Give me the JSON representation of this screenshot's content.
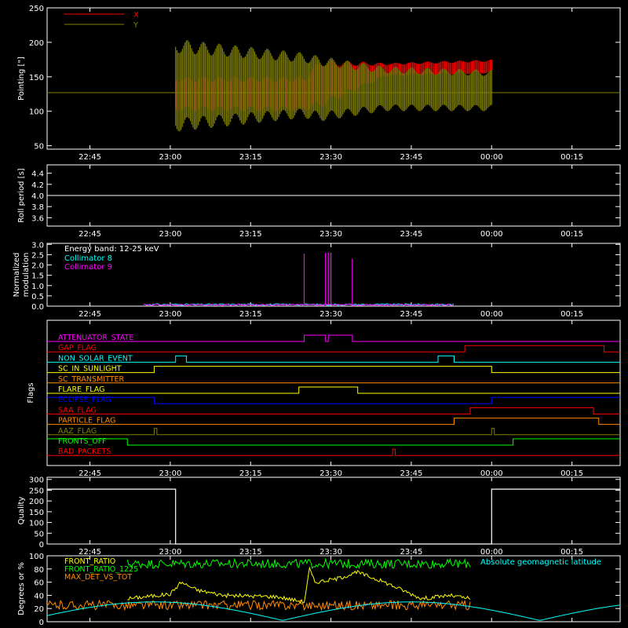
{
  "colors": {
    "background": "#000000",
    "axes": "#ffffff",
    "x": "#ff0000",
    "y": "#808000",
    "collimator8": "#00ffff",
    "collimator9": "#ff00ff",
    "front_ratio": "#ffff00",
    "front_ratio_1225": "#00ff00",
    "max_det": "#ff8c00",
    "geomag": "#00ffff"
  },
  "time_ticks": [
    "22:45",
    "23:00",
    "23:15",
    "23:30",
    "23:45",
    "00:00",
    "00:15"
  ],
  "chart_data": [
    {
      "id": "pointing",
      "type": "area",
      "ylabel": "Pointing [\"]",
      "ylim": [
        45,
        250
      ],
      "yticks": [
        "50",
        "100",
        "150",
        "200",
        "250"
      ],
      "x_range": [
        "22:37",
        "00:24"
      ],
      "legend": {
        "position": "top-left"
      },
      "reference_line": 127,
      "series": [
        {
          "name": "X",
          "color": "#ff0000",
          "x": [
            "23:01",
            "23:25",
            "23:28",
            "23:40",
            "00:00"
          ],
          "low": [
            100,
            100,
            105,
            150,
            155
          ],
          "high": [
            150,
            150,
            175,
            170,
            175
          ]
        },
        {
          "name": "Y",
          "color": "#808000",
          "x": [
            "23:01",
            "23:25",
            "23:28",
            "23:40",
            "00:00"
          ],
          "low": [
            70,
            90,
            85,
            100,
            100
          ],
          "high": [
            205,
            185,
            180,
            165,
            160
          ]
        }
      ]
    },
    {
      "id": "roll",
      "type": "line",
      "ylabel": "Roll period [s]",
      "ylim": [
        3.45,
        4.55
      ],
      "yticks": [
        "3.6",
        "3.8",
        "4.0",
        "4.2",
        "4.4"
      ],
      "x_range": [
        "22:37",
        "00:24"
      ],
      "series": [
        {
          "name": "",
          "x": [
            "22:37",
            "00:24"
          ],
          "values": [
            4.0,
            4.0
          ]
        }
      ]
    },
    {
      "id": "modulation",
      "type": "line",
      "ylabel": "Normalized modulation",
      "ylim": [
        0,
        3.05
      ],
      "yticks": [
        "0.0",
        "0.5",
        "1.0",
        "1.5",
        "2.0",
        "2.5",
        "3.0"
      ],
      "x_range": [
        "22:37",
        "00:24"
      ],
      "annotation": "Energy band: 12-25 keV",
      "series": [
        {
          "name": "Collimator 8",
          "color": "#00ffff",
          "baseline": 0.08,
          "span": [
            "22:55",
            "23:53"
          ]
        },
        {
          "name": "Collimator 9",
          "color": "#ff00ff",
          "baseline": 0.06,
          "span": [
            "22:55",
            "23:53"
          ],
          "spikes": [
            [
              "23:25",
              2.55
            ],
            [
              "23:29",
              2.6
            ],
            [
              "23:29.5",
              2.6
            ],
            [
              "23:30",
              2.6
            ],
            [
              "23:34",
              2.3
            ]
          ]
        }
      ]
    },
    {
      "id": "flags",
      "type": "line",
      "ylabel": "Flags",
      "x_range": [
        "22:37",
        "00:24"
      ],
      "rows": [
        {
          "label": "ATTENUATOR_STATE",
          "color": "#ff00ff",
          "segments": [
            [
              "22:37",
              0
            ],
            [
              "23:25",
              1
            ],
            [
              "23:29",
              0
            ],
            [
              "23:29.5",
              1
            ],
            [
              "23:34",
              0
            ],
            [
              "00:24",
              0
            ]
          ]
        },
        {
          "label": "GAP_FLAG",
          "color": "#ff0000",
          "segments": [
            [
              "22:37",
              0
            ],
            [
              "23:55",
              1
            ],
            [
              "00:21",
              0
            ],
            [
              "00:24",
              0
            ]
          ]
        },
        {
          "label": "NON_SOLAR_EVENT",
          "color": "#00ffff",
          "segments": [
            [
              "22:37",
              0
            ],
            [
              "23:01",
              1
            ],
            [
              "23:03",
              0
            ],
            [
              "23:50",
              1
            ],
            [
              "23:53",
              0
            ],
            [
              "00:24",
              0
            ]
          ]
        },
        {
          "label": "SC_IN_SUNLIGHT",
          "color": "#ffff00",
          "segments": [
            [
              "22:37",
              0
            ],
            [
              "22:57",
              1
            ],
            [
              "00:00",
              0
            ],
            [
              "00:24",
              0
            ]
          ]
        },
        {
          "label": "SC_TRANSMITTER",
          "color": "#ff8c00",
          "segments": [
            [
              "22:37",
              0
            ],
            [
              "00:24",
              0
            ]
          ]
        },
        {
          "label": "FLARE_FLAG",
          "color": "#ffff00",
          "segments": [
            [
              "22:37",
              0
            ],
            [
              "23:24",
              1
            ],
            [
              "23:35",
              0
            ],
            [
              "00:24",
              0
            ]
          ]
        },
        {
          "label": "ECLIPSE_FLAG",
          "color": "#0000ff",
          "segments": [
            [
              "22:37",
              1
            ],
            [
              "22:57",
              0
            ],
            [
              "00:00",
              1
            ],
            [
              "00:24",
              1
            ]
          ]
        },
        {
          "label": "SAA_FLAG",
          "color": "#ff0000",
          "segments": [
            [
              "22:37",
              0
            ],
            [
              "23:56",
              1
            ],
            [
              "00:19",
              0
            ],
            [
              "00:24",
              0
            ]
          ]
        },
        {
          "label": "PARTICLE_FLAG",
          "color": "#ff8c00",
          "segments": [
            [
              "22:37",
              0
            ],
            [
              "23:53",
              1
            ],
            [
              "00:20",
              0
            ],
            [
              "00:24",
              0
            ]
          ]
        },
        {
          "label": "AAZ_FLAG",
          "color": "#808000",
          "segments": [
            [
              "22:37",
              0
            ],
            [
              "22:57",
              1
            ],
            [
              "22:57.5",
              0
            ],
            [
              "00:00",
              1
            ],
            [
              "00:00.5",
              0
            ],
            [
              "00:24",
              0
            ]
          ]
        },
        {
          "label": "FRONTS_OFF",
          "color": "#00ff00",
          "segments": [
            [
              "22:37",
              1
            ],
            [
              "22:52",
              0
            ],
            [
              "00:04",
              1
            ],
            [
              "00:24",
              1
            ]
          ]
        },
        {
          "label": "BAD_PACKETS",
          "color": "#ff0000",
          "segments": [
            [
              "22:37",
              0
            ],
            [
              "23:41.5",
              1
            ],
            [
              "23:42",
              0
            ],
            [
              "00:24",
              0
            ]
          ]
        }
      ]
    },
    {
      "id": "quality",
      "type": "line",
      "ylabel": "Quality",
      "ylim": [
        0,
        310
      ],
      "yticks": [
        "0",
        "50",
        "100",
        "150",
        "200",
        "250",
        "300"
      ],
      "x_range": [
        "22:37",
        "00:24"
      ],
      "series": [
        {
          "name": "",
          "x": [
            "22:37",
            "23:01",
            "23:01",
            "00:00",
            "00:00",
            "00:24"
          ],
          "values": [
            255,
            255,
            0,
            0,
            255,
            255
          ]
        }
      ]
    },
    {
      "id": "ratios",
      "type": "line",
      "ylabel": "Degrees or %",
      "ylim": [
        0,
        100
      ],
      "yticks": [
        "0",
        "20",
        "40",
        "60",
        "80",
        "100"
      ],
      "x_range": [
        "22:37",
        "00:24"
      ],
      "legend": {
        "position": "top-left",
        "extra_label": "Absolute geomagnetic latitude",
        "extra_position": "top-right"
      },
      "series": [
        {
          "name": "FRONT_RATIO",
          "color": "#ffff00",
          "span": [
            "22:52",
            "23:56"
          ],
          "x": [
            "22:52",
            "23:00",
            "23:02",
            "23:05",
            "23:10",
            "23:20",
            "23:25",
            "23:26",
            "23:27",
            "23:31",
            "23:35",
            "23:40",
            "23:47",
            "23:52",
            "23:56"
          ],
          "values": [
            35,
            42,
            60,
            48,
            40,
            38,
            30,
            80,
            60,
            65,
            75,
            60,
            35,
            40,
            35
          ]
        },
        {
          "name": "FRONT_RATIO_1225",
          "color": "#00ff00",
          "span": [
            "22:52",
            "23:56"
          ],
          "level": 88
        },
        {
          "name": "MAX_DET_VS_TOT",
          "color": "#ff8c00",
          "span": [
            "22:37",
            "23:56"
          ],
          "level": 25
        },
        {
          "name": "Absolute geomagnetic latitude",
          "color": "#00ffff",
          "wave": {
            "amplitude": 28,
            "period_min": 96
          }
        }
      ]
    }
  ]
}
